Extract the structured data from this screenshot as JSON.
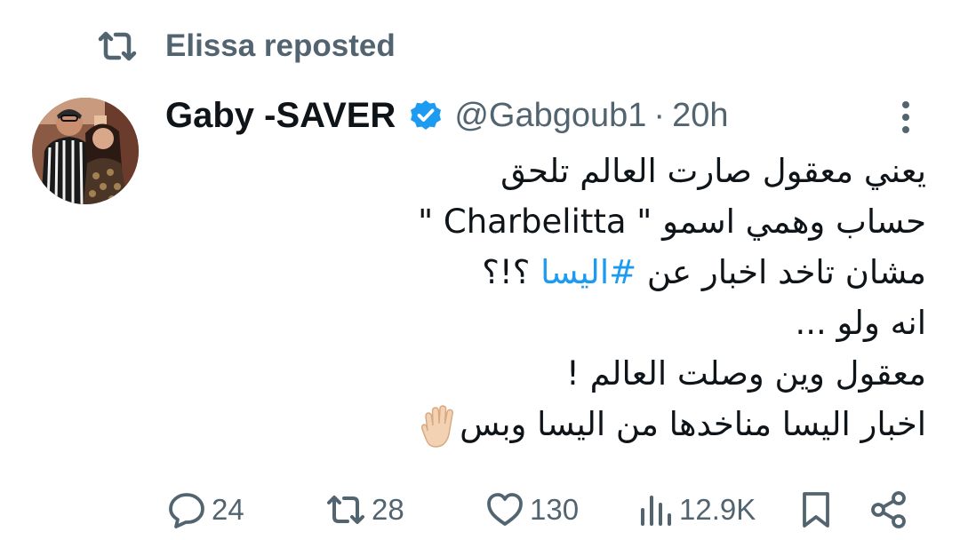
{
  "repost": {
    "label": "Elissa reposted",
    "icon": "repost-icon"
  },
  "tweet": {
    "author": {
      "display_name": "Gaby -SAVER",
      "verified": true,
      "handle": "@Gabgoub1",
      "separator": "·",
      "time": "20h"
    },
    "lines": [
      {
        "text": "يعني معقول صارت العالم تلحق"
      },
      {
        "text": "حساب وهمي اسمو \" Charbelitta \""
      },
      {
        "prefix": "مشان تاخد اخبار عن ",
        "hashtag": "#اليسا",
        "suffix": " ؟!؟"
      },
      {
        "text": "انه ولو ..."
      },
      {
        "text": "معقول وين وصلت العالم !"
      },
      {
        "text": "اخبار اليسا مناخدها من اليسا وبس",
        "emoji": "raised-hand-emoji"
      }
    ],
    "stats": {
      "replies": "24",
      "reposts": "28",
      "likes": "130",
      "views": "12.9K"
    }
  },
  "colors": {
    "text_primary": "#0f1419",
    "text_secondary": "#536471",
    "link": "#1d9bf0",
    "verified": "#1d9bf0"
  }
}
